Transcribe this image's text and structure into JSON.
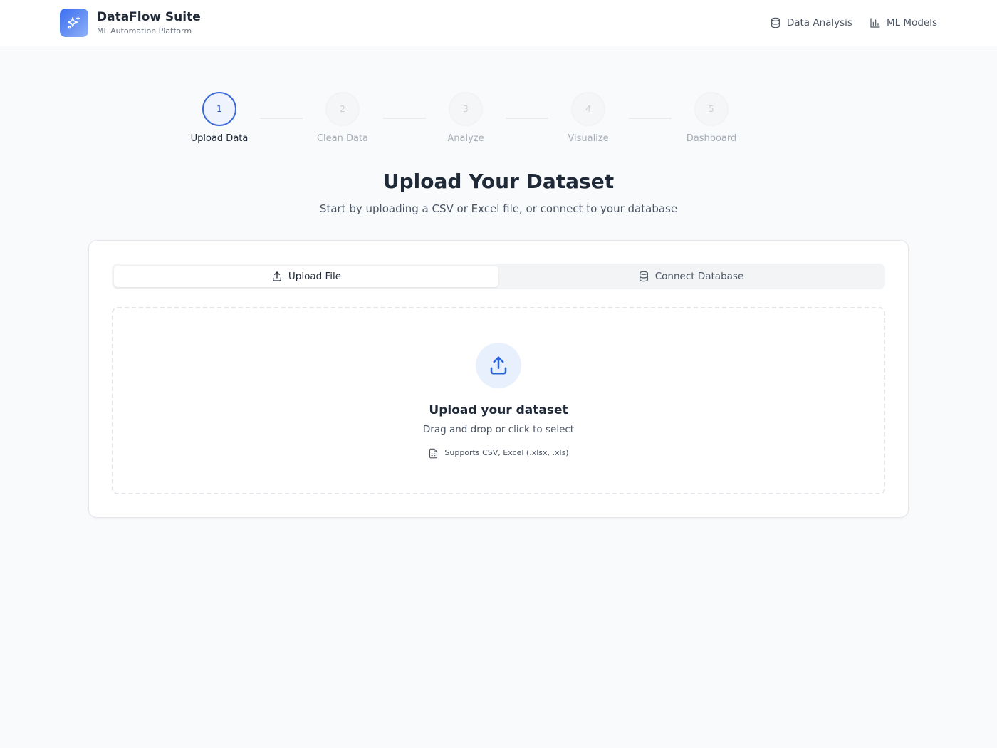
{
  "brand": {
    "title": "DataFlow Suite",
    "subtitle": "ML Automation Platform",
    "logo_icon": "sparkles-icon",
    "logo_color": "#3b6df0"
  },
  "nav": {
    "items": [
      {
        "label": "Data Analysis",
        "icon": "database-icon"
      },
      {
        "label": "ML Models",
        "icon": "bar-chart-icon"
      }
    ]
  },
  "stepper": {
    "steps": [
      {
        "number": "1",
        "label": "Upload Data",
        "state": "active"
      },
      {
        "number": "2",
        "label": "Clean Data",
        "state": "inactive"
      },
      {
        "number": "3",
        "label": "Analyze",
        "state": "inactive"
      },
      {
        "number": "4",
        "label": "Visualize",
        "state": "inactive"
      },
      {
        "number": "5",
        "label": "Dashboard",
        "state": "inactive"
      }
    ]
  },
  "page": {
    "title": "Upload Your Dataset",
    "subtitle": "Start by uploading a CSV or Excel file, or connect to your database"
  },
  "tabs": {
    "items": [
      {
        "label": "Upload File",
        "icon": "upload-icon",
        "active": true
      },
      {
        "label": "Connect Database",
        "icon": "database-icon",
        "active": false
      }
    ]
  },
  "dropzone": {
    "title": "Upload your dataset",
    "subtitle": "Drag and drop or click to select",
    "hint": "Supports CSV, Excel (.xlsx, .xls)",
    "icon": "upload-icon",
    "hint_icon": "file-spreadsheet-icon"
  },
  "colors": {
    "accent": "#3b6ad8",
    "background": "#f8fafc",
    "text": "#1f2937"
  }
}
